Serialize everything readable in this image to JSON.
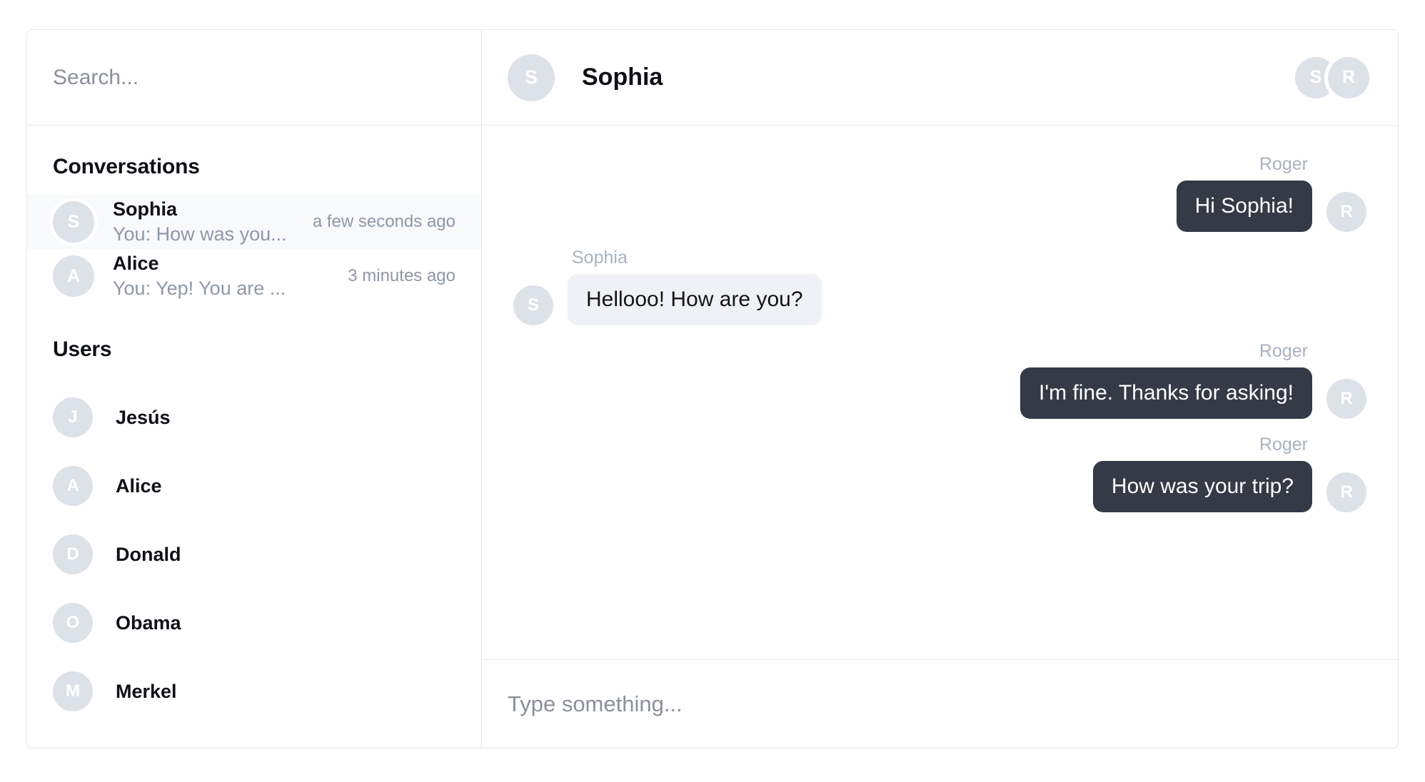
{
  "colors": {
    "accent_dark_bubble": "#343b47",
    "light_bubble": "#eef1f5",
    "avatar_bg": "#dde1e8",
    "border": "#e2e7ee",
    "muted_text": "#8d98a7",
    "active_row": "#f7f9fb"
  },
  "search": {
    "placeholder": "Search...",
    "value": ""
  },
  "sidebar": {
    "conversations_title": "Conversations",
    "users_title": "Users",
    "conversations": [
      {
        "initial": "S",
        "name": "Sophia",
        "preview": "You: How was you...",
        "time": "a few seconds ago",
        "active": true
      },
      {
        "initial": "A",
        "name": "Alice",
        "preview": "You: Yep! You are ...",
        "time": "3 minutes ago",
        "active": false
      }
    ],
    "users": [
      {
        "initial": "J",
        "name": "Jesús"
      },
      {
        "initial": "A",
        "name": "Alice"
      },
      {
        "initial": "D",
        "name": "Donald"
      },
      {
        "initial": "O",
        "name": "Obama"
      },
      {
        "initial": "M",
        "name": "Merkel"
      }
    ]
  },
  "chat": {
    "header": {
      "avatar_initial": "S",
      "title": "Sophia",
      "members": [
        {
          "initial": "S"
        },
        {
          "initial": "R"
        }
      ]
    },
    "messages": [
      {
        "author": "Roger",
        "text": "Hi Sophia!",
        "side": "out",
        "avatar_initial": "R"
      },
      {
        "author": "Sophia",
        "text": "Hellooo! How are you?",
        "side": "in",
        "avatar_initial": "S"
      },
      {
        "author": "Roger",
        "text": "I'm fine. Thanks for asking!",
        "side": "out",
        "avatar_initial": "R"
      },
      {
        "author": "Roger",
        "text": "How was your trip?",
        "side": "out",
        "avatar_initial": "R"
      }
    ],
    "composer": {
      "placeholder": "Type something...",
      "value": ""
    }
  }
}
